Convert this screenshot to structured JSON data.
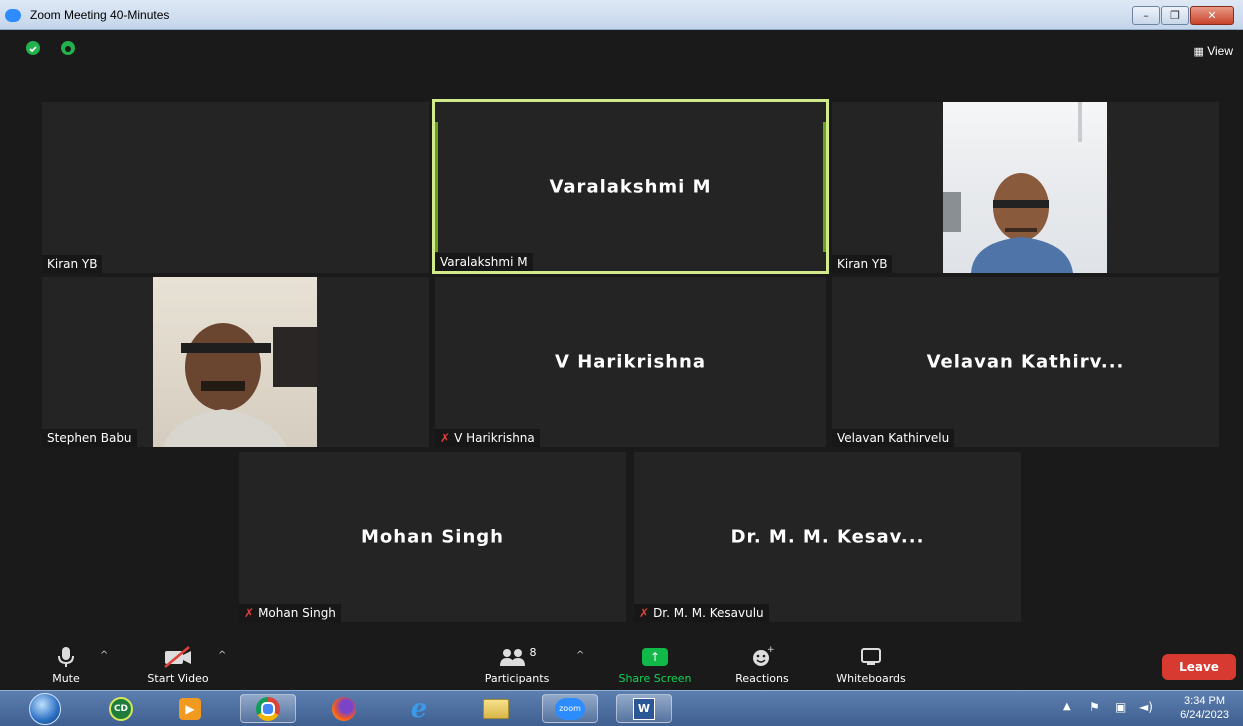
{
  "window": {
    "title": "Zoom Meeting 40-Minutes"
  },
  "top": {
    "view_label": "View",
    "view_icon": "grid-icon"
  },
  "tiles": [
    {
      "big": "",
      "label": "Kiran YB",
      "muted": false
    },
    {
      "big": "Varalakshmi M",
      "label": "Varalakshmi M",
      "muted": false,
      "active": true
    },
    {
      "big": "",
      "label": "Kiran YB",
      "muted": false
    },
    {
      "big": "",
      "label": "Stephen Babu",
      "muted": false
    },
    {
      "big": "V Harikrishna",
      "label": "V Harikrishna",
      "muted": true
    },
    {
      "big": "Velavan Kathirv...",
      "label": "Velavan Kathirvelu",
      "muted": false
    },
    {
      "big": "Mohan Singh",
      "label": "Mohan Singh",
      "muted": true
    },
    {
      "big": "Dr. M. M. Kesav...",
      "label": "Dr. M. M. Kesavulu",
      "muted": true
    }
  ],
  "toolbar": {
    "mute": "Mute",
    "start_video": "Start Video",
    "participants": "Participants",
    "participants_count": "8",
    "share_screen": "Share Screen",
    "reactions": "Reactions",
    "whiteboards": "Whiteboards",
    "leave": "Leave"
  },
  "taskbar": {
    "time": "3:34 PM",
    "date": "6/24/2023",
    "zoom_label": "zoom"
  },
  "colors": {
    "active_border": "#d3ea8c",
    "leave": "#d73a31",
    "share_green": "#10b948",
    "mute_red": "#e0413a"
  }
}
